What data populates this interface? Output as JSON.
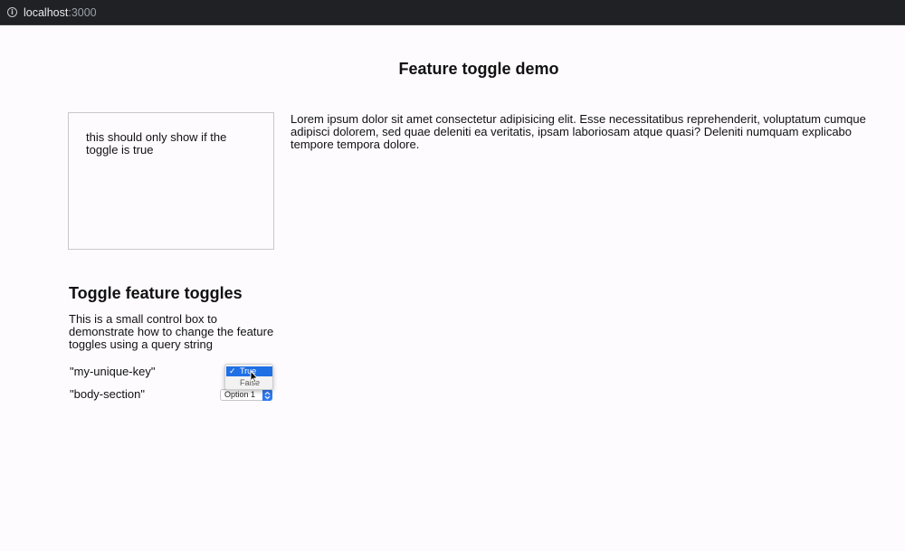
{
  "browser": {
    "host": "localhost",
    "port": ":3000"
  },
  "page": {
    "title": "Feature toggle demo"
  },
  "feature_box": {
    "text": "this should only show if the toggle is true"
  },
  "body_section": {
    "text": "Lorem ipsum dolor sit amet consectetur adipisicing elit. Esse necessitatibus reprehenderit, voluptatum cumque adipisci dolorem, sed quae deleniti ea veritatis, ipsam laboriosam atque quasi? Deleniti numquam explicabo tempore tempora dolore."
  },
  "controls": {
    "heading": "Toggle feature toggles",
    "description": "This is a small control box to demonstrate how to change the feature toggles using a query string",
    "toggles": [
      {
        "key": "\"my-unique-key\"",
        "options": [
          "True",
          "False"
        ],
        "selected": "True",
        "dropdown_open": true
      },
      {
        "key": "\"body-section\"",
        "selected": "Option 1"
      }
    ]
  },
  "colors": {
    "accent": "#1f6fe5",
    "page_background": "#fdfbfe",
    "browser_bar": "#202124"
  },
  "icons": {
    "info": "info-icon",
    "check": "check-icon",
    "cursor": "cursor-icon",
    "select_arrows": "chevron-updown-icon"
  }
}
